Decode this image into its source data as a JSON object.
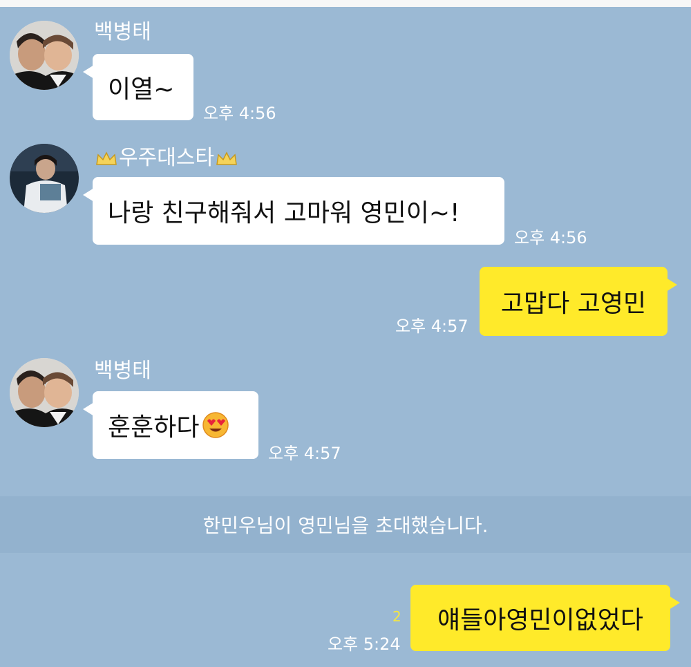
{
  "messages": [
    {
      "sender": "백병태",
      "text": "이열~",
      "time": "오후 4:56"
    },
    {
      "sender": "우주대스타",
      "text": "나랑 친구해줘서 고마워 영민이~!",
      "time": "오후 4:56"
    },
    {
      "text": "고맙다 고영민",
      "time": "오후 4:57"
    },
    {
      "sender": "백병태",
      "text": "훈훈하다",
      "time": "오후 4:57",
      "emoji": "heart-eyes-emoji"
    },
    {
      "text": "얘들아영민이없었다",
      "time": "오후 5:24",
      "unread": "2"
    }
  ],
  "system": {
    "text": "한민우님이 영민님을 초대했습니다."
  },
  "colors": {
    "background": "#9bb9d4",
    "incoming_bubble": "#ffffff",
    "outgoing_bubble": "#ffea2a",
    "unread": "#f5e640"
  }
}
